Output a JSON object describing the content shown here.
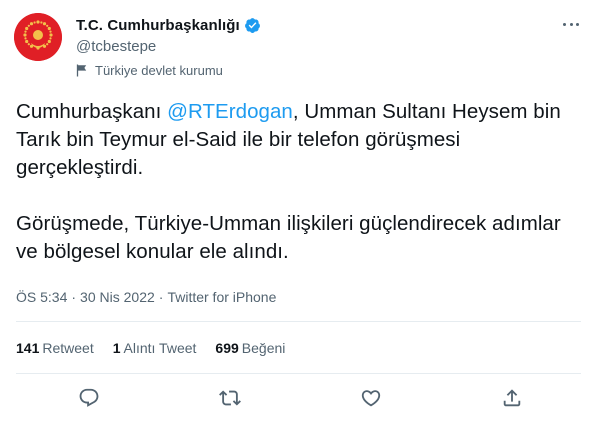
{
  "author": {
    "display_name": "T.C. Cumhurbaşkanlığı",
    "handle": "@tcbestepe",
    "label": "Türkiye devlet kurumu",
    "avatar_color": "#e01f26",
    "verified_color": "#1d9bf0",
    "avatar_icon": "presidential-seal-icon",
    "verified_icon": "verified-badge-icon",
    "label_icon": "flag-icon"
  },
  "tweet": {
    "text_before_mention": "Cumhurbaşkanı ",
    "mention": "@RTErdogan",
    "text_after_mention": ", Umman Sultanı Heysem bin Tarık bin Teymur el-Said ile bir telefon görüşmesi gerçekleştirdi.",
    "paragraph2": "Görüşmede, Türkiye-Umman ilişkileri güçlendirecek adımlar ve bölgesel konular ele alındı.",
    "mention_color": "#1d9bf0"
  },
  "meta": {
    "time": "ÖS 5:34",
    "date": "30 Nis 2022",
    "source": "Twitter for iPhone",
    "separator": "·"
  },
  "stats": {
    "retweets": {
      "count": "141",
      "label": "Retweet"
    },
    "quotes": {
      "count": "1",
      "label": "Alıntı Tweet"
    },
    "likes": {
      "count": "699",
      "label": "Beğeni"
    }
  },
  "actions": {
    "reply_icon": "reply-icon",
    "retweet_icon": "retweet-icon",
    "like_icon": "like-icon",
    "share_icon": "share-icon",
    "more_icon": "more-options-icon"
  }
}
